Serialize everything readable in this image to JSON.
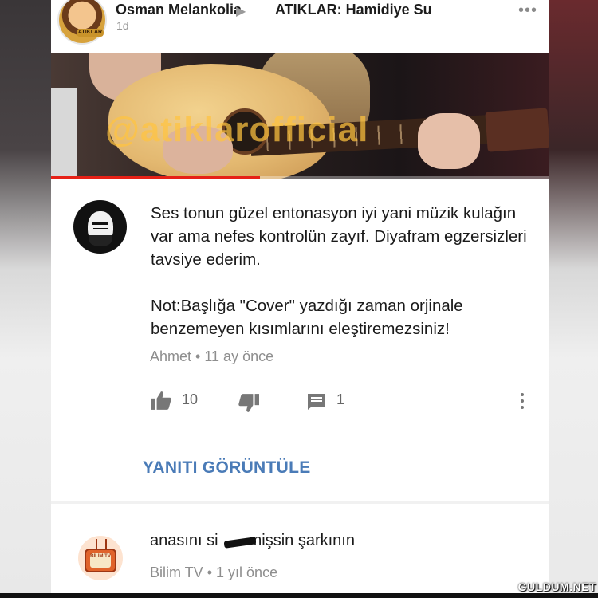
{
  "post": {
    "author": "Osman Melankolia",
    "arrow": "▶",
    "group": "ATIKLAR: Hamidiye Su",
    "time": "1d",
    "more": "•••",
    "avatar_badge": "ATIKLAR"
  },
  "video": {
    "watermark": "@atiklarofficial",
    "progress": 0.42,
    "progress_color": "#e62117"
  },
  "comments": [
    {
      "text_lines": [
        "Ses tonun güzel entonasyon iyi yani müzik kulağın var ama nefes kontrolün zayıf. Diyafram egzersizleri tavsiye ederim.",
        "Not:Başlığa \"Cover\" yazdığı zaman orjinale benzemeyen kısımlarını eleştiremezsiniz!"
      ],
      "author": "Ahmet",
      "separator": "•",
      "time": "11 ay önce",
      "likes": "10",
      "replies": "1",
      "view_replies": "YANITI GÖRÜNTÜLE"
    },
    {
      "text_before": "anasını si",
      "text_after": "mişsin şarkının",
      "author": "Bilim TV",
      "separator": "•",
      "time": "1 yıl önce",
      "avatar_text": "BİLİM TV"
    }
  ],
  "site_watermark": "GULDUM.NET",
  "colors": {
    "link": "#4a7bb7",
    "meta": "#8e8e8e",
    "text": "#1a1a1a"
  },
  "icons": [
    "thumbs-up-icon",
    "thumbs-down-icon",
    "reply-icon",
    "kebab-menu-icon",
    "more-dots-icon"
  ]
}
